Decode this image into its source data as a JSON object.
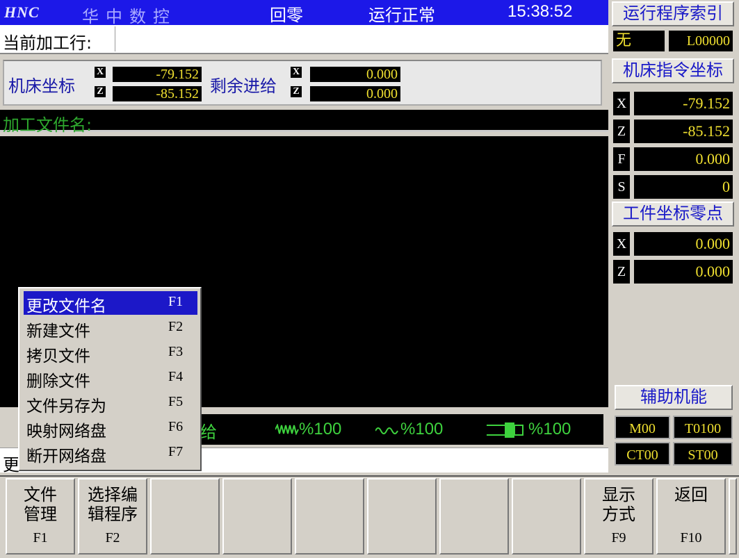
{
  "titlebar": {
    "logo": "HNC",
    "brand": "华中数控",
    "mode": "回零",
    "status": "运行正常",
    "clock": "15:38:52"
  },
  "current_line": {
    "label": "当前加工行:"
  },
  "machine_coord": {
    "label": "机床坐标",
    "x_tag": "X",
    "x_val": "-79.152",
    "z_tag": "Z",
    "z_val": "-85.152"
  },
  "remaining_feed": {
    "label": "剩余进给",
    "x_tag": "X",
    "x_val": "0.000",
    "z_tag": "Z",
    "z_val": "0.000"
  },
  "file_name": {
    "label": "加工文件名:"
  },
  "feed_bar": {
    "prefix": "给",
    "feed_override": "%100",
    "spindle_override": "%100",
    "rapid_override": "%100"
  },
  "message_line": {
    "text": "更"
  },
  "popup_menu": {
    "items": [
      {
        "label": "更改文件名",
        "key": "F1",
        "selected": true
      },
      {
        "label": "新建文件",
        "key": "F2"
      },
      {
        "label": "拷贝文件",
        "key": "F3"
      },
      {
        "label": "删除文件",
        "key": "F4"
      },
      {
        "label": "文件另存为",
        "key": "F5"
      },
      {
        "label": "映射网络盘",
        "key": "F6"
      },
      {
        "label": "断开网络盘",
        "key": "F7"
      }
    ]
  },
  "right_panel": {
    "program_index_title": "运行程序索引",
    "program_name": "无",
    "line_number": "L00000",
    "machine_cmd_title": "机床指令坐标",
    "cmd": [
      {
        "tag": "X",
        "value": "-79.152"
      },
      {
        "tag": "Z",
        "value": "-85.152"
      },
      {
        "tag": "F",
        "value": "0.000"
      },
      {
        "tag": "S",
        "value": "0"
      }
    ],
    "workpiece_zero_title": "工件坐标零点",
    "zero": [
      {
        "tag": "X",
        "value": "0.000"
      },
      {
        "tag": "Z",
        "value": "0.000"
      }
    ],
    "aux_title": "辅助机能",
    "aux": {
      "m": "M00",
      "t": "T0100",
      "ct": "CT00",
      "st": "ST00"
    }
  },
  "softkeys": [
    {
      "line1": "文件",
      "line2": "管理",
      "key": "F1"
    },
    {
      "line1": "选择编",
      "line2": "辑程序",
      "key": "F2"
    },
    {
      "line1": "",
      "line2": "",
      "key": ""
    },
    {
      "line1": "",
      "line2": "",
      "key": ""
    },
    {
      "line1": "",
      "line2": "",
      "key": ""
    },
    {
      "line1": "",
      "line2": "",
      "key": ""
    },
    {
      "line1": "",
      "line2": "",
      "key": ""
    },
    {
      "line1": "",
      "line2": "",
      "key": ""
    },
    {
      "line1": "显示",
      "line2": "方式",
      "key": "F9"
    },
    {
      "line1": "返回",
      "line2": "",
      "key": "F10"
    }
  ],
  "colors": {
    "title_bg": "#1c18e8",
    "value_yellow": "#f0e030",
    "label_blue": "#1a1aa8",
    "file_label_green": "#2ea82e",
    "menu_selected": "#1c18c8"
  }
}
